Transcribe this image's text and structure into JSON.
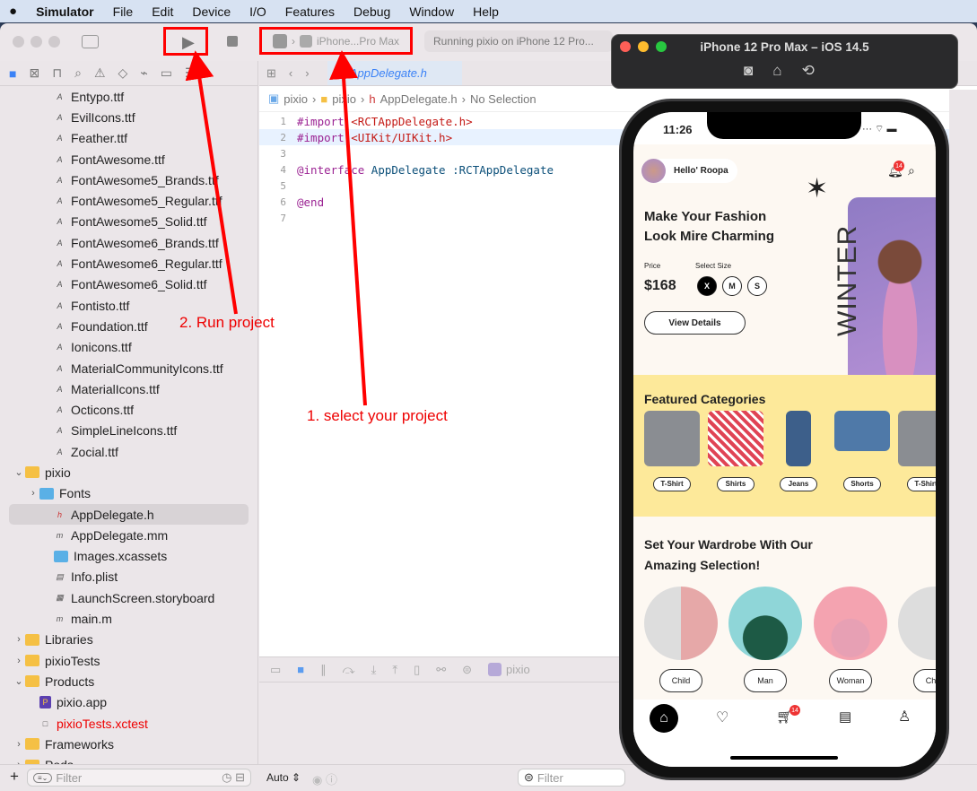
{
  "menubar": {
    "app": "Simulator",
    "items": [
      "File",
      "Edit",
      "Device",
      "I/O",
      "Features",
      "Debug",
      "Window",
      "Help"
    ]
  },
  "toolbar": {
    "scheme": "iPhone...Pro Max",
    "status": "Running pixio on iPhone 12 Pro..."
  },
  "navigator": {
    "files": [
      {
        "name": "Entypo.ttf",
        "type": "font",
        "indent": 3
      },
      {
        "name": "EvilIcons.ttf",
        "type": "font",
        "indent": 3
      },
      {
        "name": "Feather.ttf",
        "type": "font",
        "indent": 3
      },
      {
        "name": "FontAwesome.ttf",
        "type": "font",
        "indent": 3
      },
      {
        "name": "FontAwesome5_Brands.ttf",
        "type": "font",
        "indent": 3
      },
      {
        "name": "FontAwesome5_Regular.ttf",
        "type": "font",
        "indent": 3
      },
      {
        "name": "FontAwesome5_Solid.ttf",
        "type": "font",
        "indent": 3
      },
      {
        "name": "FontAwesome6_Brands.ttf",
        "type": "font",
        "indent": 3
      },
      {
        "name": "FontAwesome6_Regular.ttf",
        "type": "font",
        "indent": 3
      },
      {
        "name": "FontAwesome6_Solid.ttf",
        "type": "font",
        "indent": 3
      },
      {
        "name": "Fontisto.ttf",
        "type": "font",
        "indent": 3
      },
      {
        "name": "Foundation.ttf",
        "type": "font",
        "indent": 3
      },
      {
        "name": "Ionicons.ttf",
        "type": "font",
        "indent": 3
      },
      {
        "name": "MaterialCommunityIcons.ttf",
        "type": "font",
        "indent": 3
      },
      {
        "name": "MaterialIcons.ttf",
        "type": "font",
        "indent": 3
      },
      {
        "name": "Octicons.ttf",
        "type": "font",
        "indent": 3
      },
      {
        "name": "SimpleLineIcons.ttf",
        "type": "font",
        "indent": 3
      },
      {
        "name": "Zocial.ttf",
        "type": "font",
        "indent": 3
      },
      {
        "name": "pixio",
        "type": "folder",
        "indent": 1,
        "chev": "⌄"
      },
      {
        "name": "Fonts",
        "type": "bluefolder",
        "indent": 2,
        "chev": "›"
      },
      {
        "name": "AppDelegate.h",
        "type": "h",
        "indent": 3,
        "selected": true
      },
      {
        "name": "AppDelegate.mm",
        "type": "m",
        "indent": 3
      },
      {
        "name": "Images.xcassets",
        "type": "bluefolder",
        "indent": 3
      },
      {
        "name": "Info.plist",
        "type": "plist",
        "indent": 3
      },
      {
        "name": "LaunchScreen.storyboard",
        "type": "sb",
        "indent": 3
      },
      {
        "name": "main.m",
        "type": "m",
        "indent": 3
      },
      {
        "name": "Libraries",
        "type": "folder",
        "indent": 1,
        "chev": "›"
      },
      {
        "name": "pixioTests",
        "type": "folder",
        "indent": 1,
        "chev": "›"
      },
      {
        "name": "Products",
        "type": "folder",
        "indent": 1,
        "chev": "⌄"
      },
      {
        "name": "pixio.app",
        "type": "app",
        "indent": 2
      },
      {
        "name": "pixioTests.xctest",
        "type": "test",
        "indent": 2,
        "red": true
      },
      {
        "name": "Frameworks",
        "type": "folder",
        "indent": 1,
        "chev": "›"
      },
      {
        "name": "Pods",
        "type": "folder",
        "indent": 1,
        "chev": "›"
      }
    ],
    "filter_placeholder": "Filter"
  },
  "editor": {
    "tab": "AppDelegate.h",
    "jump": [
      "pixio",
      "pixio",
      "AppDelegate.h",
      "No Selection"
    ],
    "lines": [
      [
        "1",
        "#import",
        "<RCTAppDelegate.h>",
        ""
      ],
      [
        "2",
        "#import",
        "<UIKit/UIKit.h>",
        ""
      ],
      [
        "3",
        "",
        "",
        ""
      ],
      [
        "4",
        "@interface",
        "AppDelegate : ",
        "RCTAppDelegate"
      ],
      [
        "5",
        "",
        "",
        ""
      ],
      [
        "6",
        "@end",
        "",
        ""
      ],
      [
        "7",
        "",
        "",
        ""
      ]
    ]
  },
  "debug": {
    "target": "pixio",
    "auto": "Auto",
    "filter_placeholder": "Filter"
  },
  "simulator": {
    "title": "iPhone 12 Pro Max – iOS 14.5"
  },
  "app": {
    "time": "11:26",
    "greeting": "Hello' Roopa",
    "notif_count": "14",
    "hero_title_1": "Make Your Fashion",
    "hero_title_2": "Look Mire Charming",
    "price_label": "Price",
    "price": "$168",
    "size_label": "Select Size",
    "sizes": [
      "X",
      "M",
      "S"
    ],
    "view_details": "View Details",
    "winter": "WINTER",
    "featured_title": "Featured Categories",
    "categories": [
      "T-Shirt",
      "Shirts",
      "Jeans",
      "Shorts",
      "T-Shirt"
    ],
    "wardrobe_1": "Set Your Wardrobe With Our",
    "wardrobe_2": "Amazing Selection!",
    "groups": [
      "Child",
      "Man",
      "Woman",
      "Child"
    ],
    "cart_count": "14"
  },
  "annotations": {
    "run": "2. Run project",
    "select": "1. select your project"
  },
  "colors": {
    "annotation": "#ff0000",
    "featured_bg": "#fde99a",
    "accent_badge": "#e33333"
  }
}
